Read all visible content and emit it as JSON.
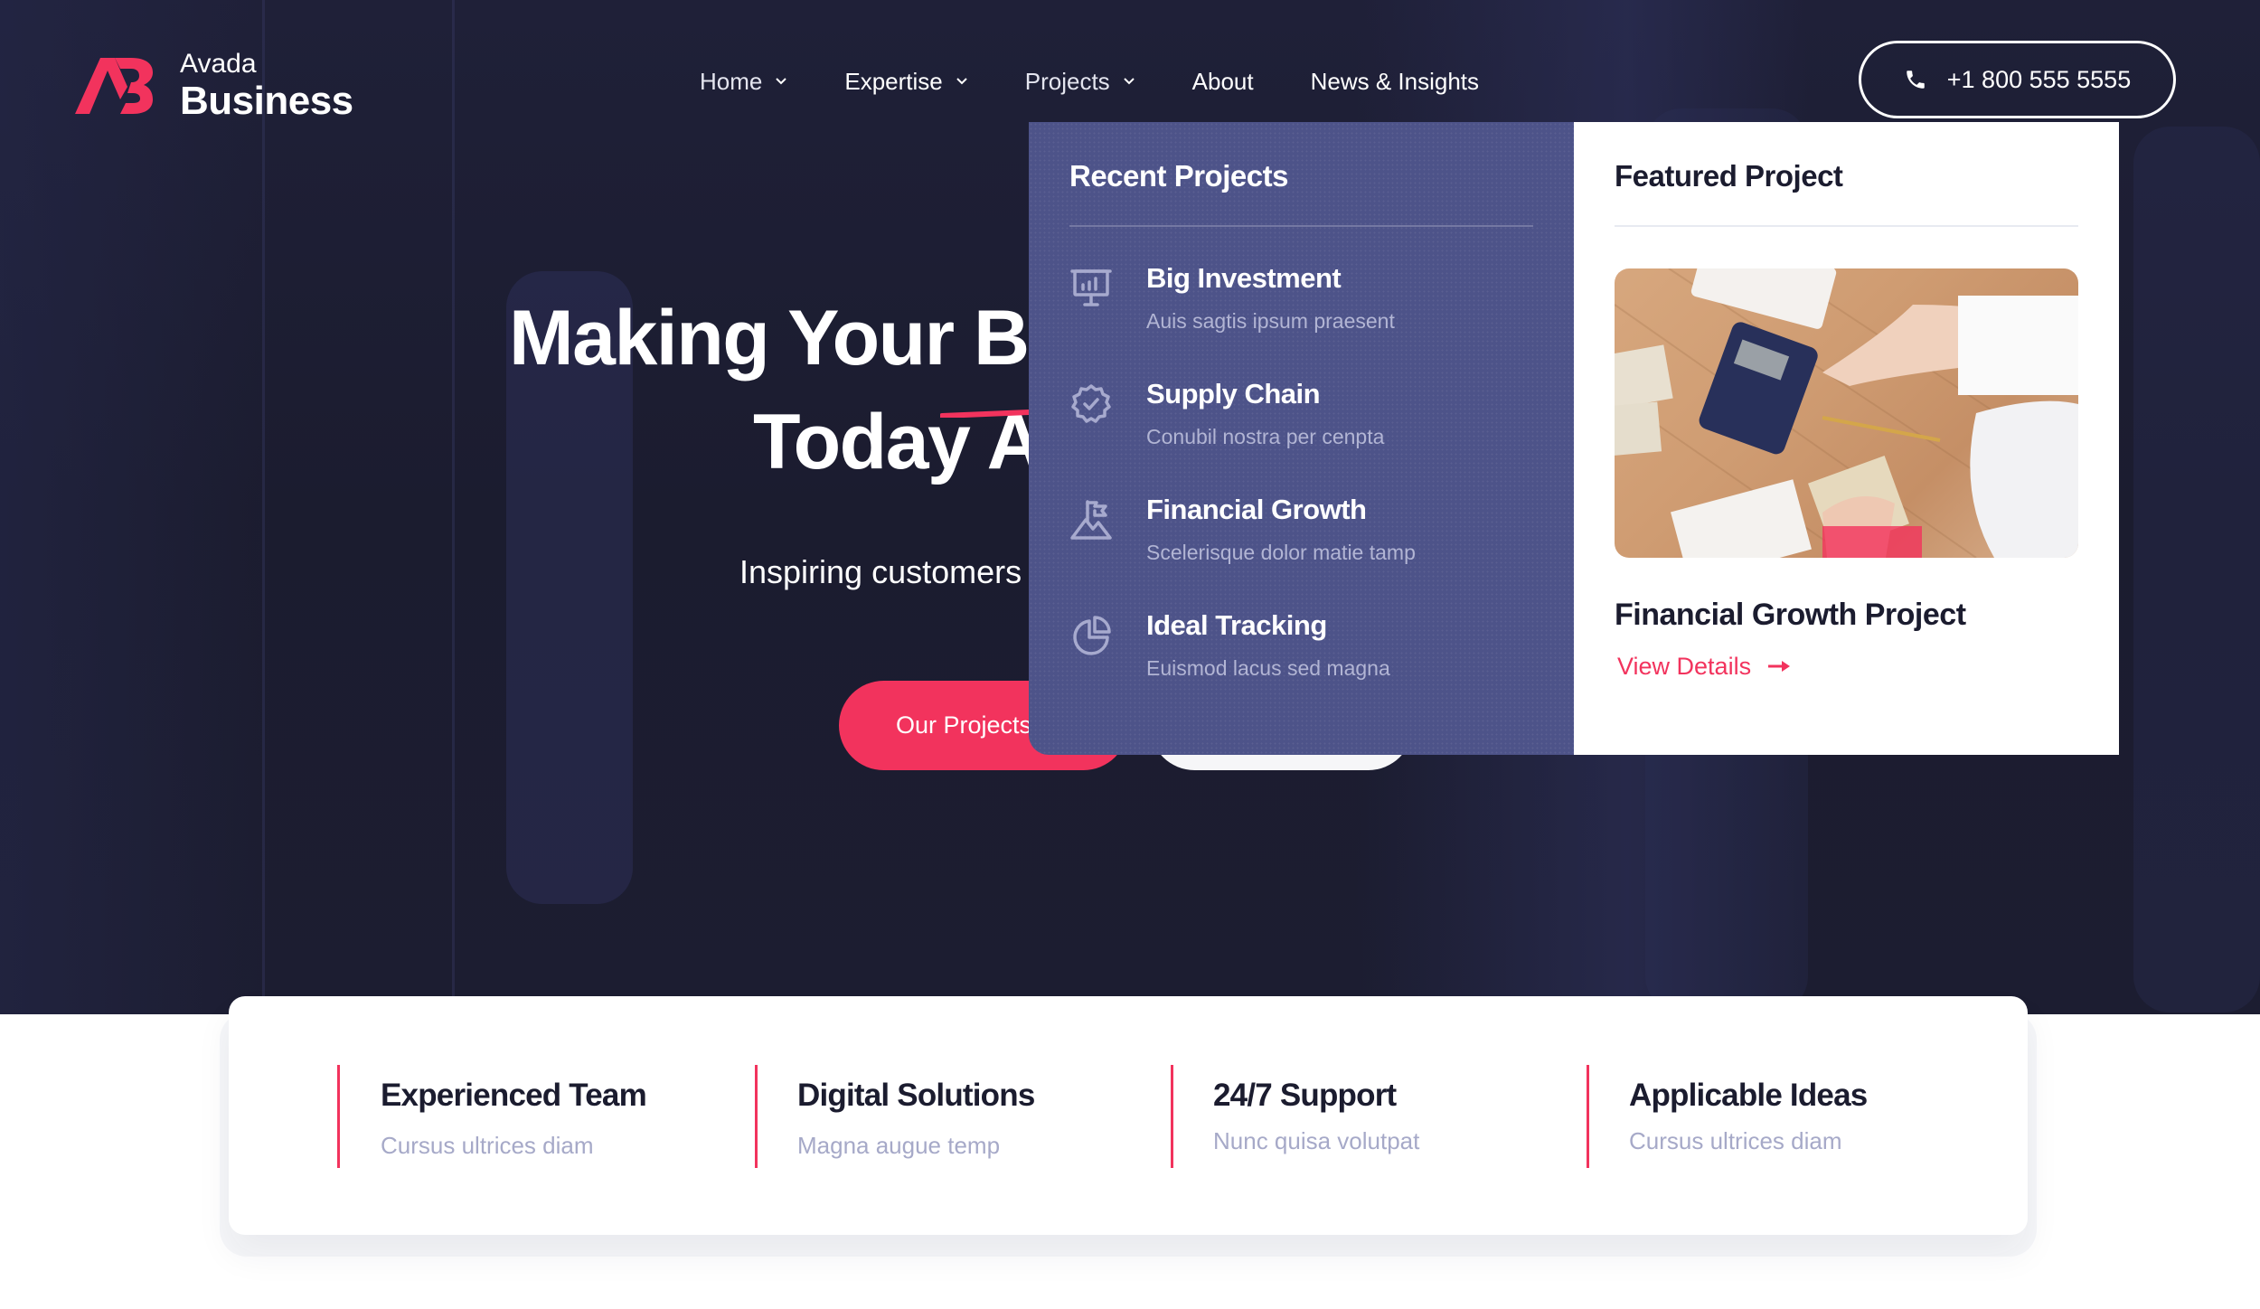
{
  "brand": {
    "name_top": "Avada",
    "name_bottom": "Business",
    "logo_icon": "ab-monogram-icon",
    "accent_color": "#f2335d",
    "dark_color": "#1b1c2f",
    "dropdown_color": "#4d5389"
  },
  "nav": {
    "items": [
      {
        "label": "Home",
        "has_dropdown": true
      },
      {
        "label": "Expertise",
        "has_dropdown": true
      },
      {
        "label": "Projects",
        "has_dropdown": true
      },
      {
        "label": "About",
        "has_dropdown": false
      },
      {
        "label": "News & Insights",
        "has_dropdown": false
      }
    ],
    "phone": {
      "icon": "phone-icon",
      "label": "+1 800 555 5555"
    }
  },
  "hero": {
    "title_line1": "Making Your Bu",
    "title_line2": "Today A",
    "subtitle": "Inspiring customers",
    "primary_button": "Our Projects",
    "secondary_button": ""
  },
  "projects_menu": {
    "recent": {
      "heading": "Recent Projects",
      "items": [
        {
          "icon": "presentation-chart-icon",
          "title": "Big Investment",
          "subtitle": "Auis sagtis ipsum praesent"
        },
        {
          "icon": "gear-check-icon",
          "title": "Supply Chain",
          "subtitle": "Conubil nostra per cenpta"
        },
        {
          "icon": "mountain-flag-icon",
          "title": "Financial Growth",
          "subtitle": "Scelerisque dolor matie tamp"
        },
        {
          "icon": "pie-chart-icon",
          "title": "Ideal Tracking",
          "subtitle": "Euismod lacus sed magna"
        }
      ]
    },
    "featured": {
      "heading": "Featured Project",
      "image_alt": "Hands using a calculator with cash on a wooden desk",
      "title": "Financial Growth Project",
      "link_label": "View Details",
      "link_icon": "arrow-right-icon"
    }
  },
  "features": [
    {
      "title": "Experienced Team",
      "subtitle": "Cursus ultrices diam"
    },
    {
      "title": "Digital Solutions",
      "subtitle": "Magna augue temp"
    },
    {
      "title": "24/7 Support",
      "subtitle": "Nunc quisa volutpat"
    },
    {
      "title": "Applicable Ideas",
      "subtitle": "Cursus ultrices diam"
    }
  ]
}
